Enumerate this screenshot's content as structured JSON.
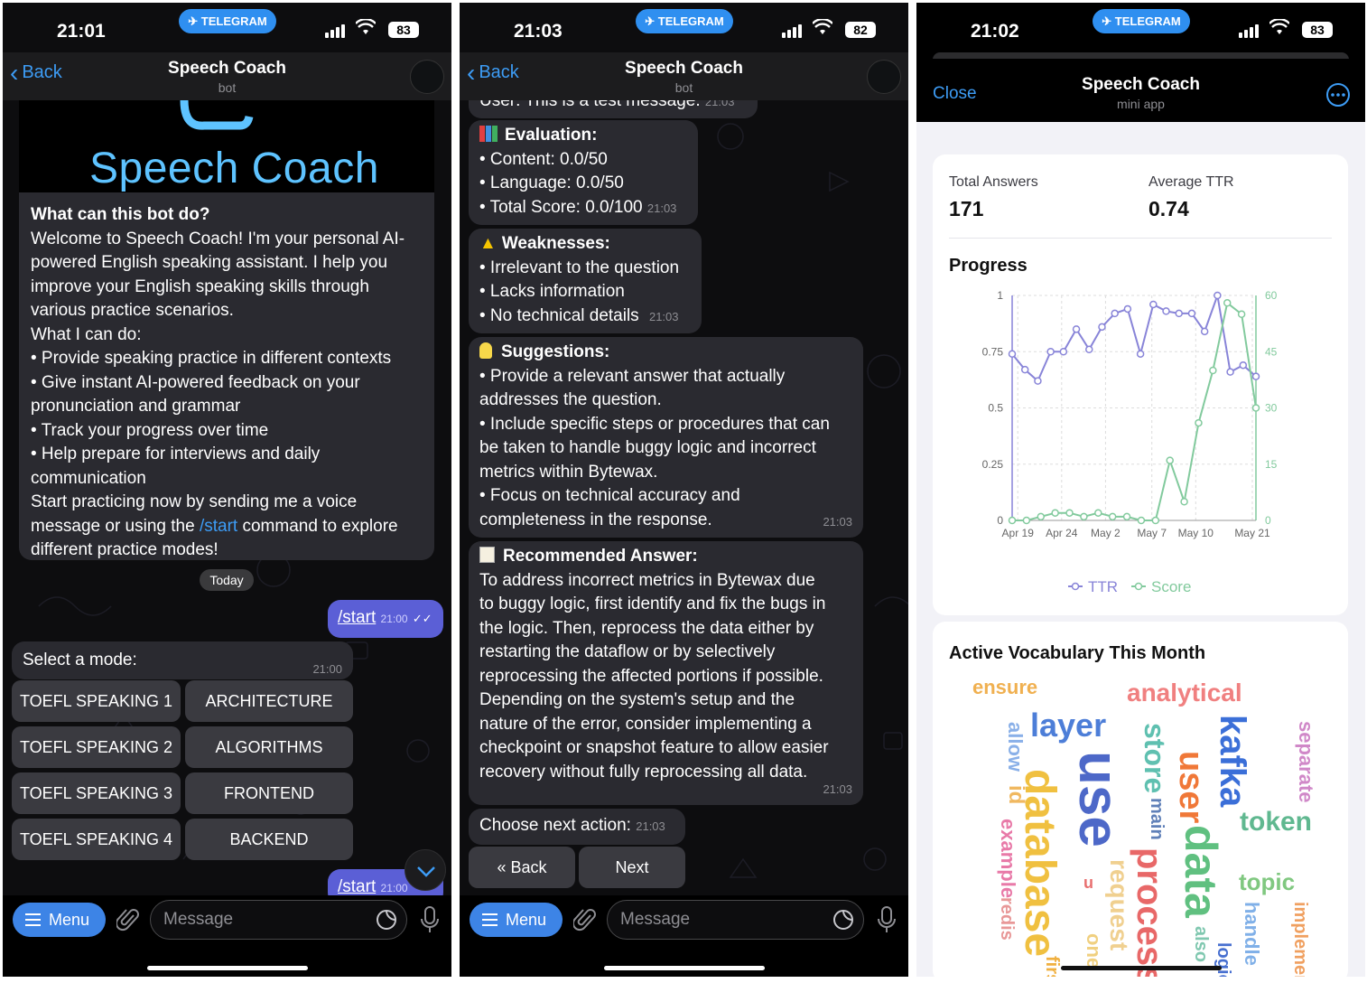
{
  "status": {
    "panel1_time": "21:01",
    "panel2_time": "21:03",
    "panel3_time": "21:02",
    "telegram": "TELEGRAM",
    "panel1_battery": "83",
    "panel2_battery": "82",
    "panel3_battery": "83"
  },
  "chat": {
    "back_label": "Back",
    "title": "Speech Coach",
    "subtitle": "bot",
    "menu_label": "Menu",
    "message_placeholder": "Message"
  },
  "panel1": {
    "logo_text": "Speech Coach",
    "intro_heading": "What can this bot do?",
    "intro_lines": [
      "Welcome to Speech Coach! I'm your personal AI-",
      "powered English speaking assistant. I help you",
      "improve your English speaking skills through",
      "various practice scenarios.",
      "What I can do:",
      "• Provide speaking practice in different contexts",
      "• Give instant AI-powered feedback on your",
      "pronunciation and grammar",
      "• Track your progress over time",
      "• Help prepare for interviews and daily",
      "communication",
      "Start practicing now by sending me a voice",
      "message or using the",
      "/start",
      "command to explore",
      "different practice modes!"
    ],
    "date_chip": "Today",
    "out_message": "/start",
    "out_time": "21:00",
    "select_text": "Select a mode:",
    "select_time": "21:00",
    "keyboard": [
      [
        "TOEFL SPEAKING 1",
        "ARCHITECTURE"
      ],
      [
        "TOEFL SPEAKING 2",
        "ALGORITHMS"
      ],
      [
        "TOEFL SPEAKING 3",
        "FRONTEND"
      ],
      [
        "TOEFL SPEAKING 4",
        "BACKEND"
      ]
    ],
    "out_message2": "/start",
    "out_time2": "21:00"
  },
  "panel2": {
    "cut_text": "User: This is a test message.",
    "cut_time": "21:03",
    "evaluation_title": "Evaluation:",
    "evaluation_lines": [
      "• Content: 0.0/50",
      "• Language: 0.0/50",
      "• Total Score: 0.0/100"
    ],
    "evaluation_time": "21:03",
    "weak_title": "Weaknesses:",
    "weak_lines": [
      "• Irrelevant to the question",
      "• Lacks information",
      "• No technical details"
    ],
    "weak_time": "21:03",
    "sugg_title": "Suggestions:",
    "sugg_lines": [
      "• Provide a relevant answer that actually",
      "addresses the question.",
      "• Include specific steps or procedures that can",
      "be taken to handle buggy logic and incorrect",
      "metrics within Bytewax.",
      "• Focus on technical accuracy and",
      "completeness in the response."
    ],
    "sugg_time": "21:03",
    "rec_title": "Recommended Answer:",
    "rec_lines": [
      "To address incorrect metrics in Bytewax due",
      "to buggy logic, first identify and fix the bugs in",
      "the logic. Then, reprocess the data either by",
      "restarting the dataflow or by selectively",
      "reprocessing the affected portions if possible.",
      "Depending on the system's setup and the",
      "nature of the error, consider implementing a",
      "checkpoint or snapshot feature to allow easier",
      "recovery without fully reprocessing all data."
    ],
    "rec_time": "21:03",
    "next_text": "Choose next action:",
    "next_time": "21:03",
    "btn_back": "« Back",
    "btn_next": "Next"
  },
  "panel3": {
    "close": "Close",
    "title": "Speech Coach",
    "subtitle": "mini app",
    "total_label": "Total Answers",
    "total_value": "171",
    "avg_label": "Average TTR",
    "avg_value": "0.74",
    "progress_title": "Progress",
    "vocab_title": "Active Vocabulary This Month"
  },
  "chart_data": {
    "type": "line",
    "title": "Progress",
    "x_ticks": [
      "Apr 19",
      "Apr 24",
      "May 2",
      "May 7",
      "May 10",
      "May 21"
    ],
    "y_left_ticks": [
      "0",
      "0.25",
      "0.5",
      "0.75",
      "1"
    ],
    "y_right_ticks": [
      "0",
      "15",
      "30",
      "45",
      "60"
    ],
    "ylim_left": [
      0,
      1
    ],
    "ylim_right": [
      0,
      60
    ],
    "grid": true,
    "legend_position": "bottom",
    "series": [
      {
        "name": "TTR",
        "axis": "left",
        "color": "#8884d8",
        "values": [
          0.74,
          0.67,
          0.62,
          0.75,
          0.75,
          0.85,
          0.76,
          0.86,
          0.92,
          0.94,
          0.74,
          0.96,
          0.93,
          0.92,
          0.92,
          0.84,
          1.0,
          0.66,
          0.69,
          0.64
        ]
      },
      {
        "name": "Score",
        "axis": "right",
        "color": "#82ca9d",
        "values": [
          0,
          0,
          1,
          2,
          2,
          1,
          2,
          1,
          1,
          0,
          0,
          16,
          5,
          26,
          40,
          58,
          55,
          30
        ]
      }
    ]
  },
  "wordcloud": [
    {
      "w": "ensure",
      "c": "#f0b050",
      "s": 22,
      "x": 62,
      "y": 747,
      "r": 0
    },
    {
      "w": "analytical",
      "c": "#f08080",
      "s": 28,
      "x": 233,
      "y": 750,
      "r": 0
    },
    {
      "w": "layer",
      "c": "#4d7ed8",
      "s": 36,
      "x": 126,
      "y": 782,
      "r": 0
    },
    {
      "w": "allow",
      "c": "#8ab0e8",
      "s": 22,
      "x": 98,
      "y": 796,
      "r": 90
    },
    {
      "w": "store",
      "c": "#5fc0b0",
      "s": 32,
      "x": 248,
      "y": 797,
      "r": 90
    },
    {
      "w": "kafka",
      "c": "#3b6fd8",
      "s": 40,
      "x": 330,
      "y": 788,
      "r": 90
    },
    {
      "w": "separate",
      "c": "#d088c8",
      "s": 22,
      "x": 420,
      "y": 795,
      "r": 90
    },
    {
      "w": "use",
      "c": "#4d68c8",
      "s": 62,
      "x": 170,
      "y": 828,
      "r": 90
    },
    {
      "w": "user",
      "c": "#f07838",
      "s": 38,
      "x": 285,
      "y": 828,
      "r": 90
    },
    {
      "w": "id",
      "c": "#f0b860",
      "s": 24,
      "x": 98,
      "y": 866,
      "r": 90
    },
    {
      "w": "main",
      "c": "#5f80b8",
      "s": 20,
      "x": 256,
      "y": 880,
      "r": 90
    },
    {
      "w": "token",
      "c": "#60b890",
      "s": 30,
      "x": 358,
      "y": 892,
      "r": 0
    },
    {
      "w": "database",
      "c": "#f0c040",
      "s": 48,
      "x": 112,
      "y": 848,
      "r": 90
    },
    {
      "w": "example",
      "c": "#e87aa8",
      "s": 22,
      "x": 90,
      "y": 903,
      "r": 90
    },
    {
      "w": "data",
      "c": "#60c080",
      "s": 50,
      "x": 290,
      "y": 910,
      "r": 90
    },
    {
      "w": "request",
      "c": "#f0d090",
      "s": 28,
      "x": 210,
      "y": 948,
      "r": 90
    },
    {
      "w": "process",
      "c": "#e86868",
      "s": 40,
      "x": 238,
      "y": 935,
      "r": 90
    },
    {
      "w": "topic",
      "c": "#80c880",
      "s": 26,
      "x": 357,
      "y": 960,
      "r": 0
    },
    {
      "w": "redis",
      "c": "#e89898",
      "s": 20,
      "x": 90,
      "y": 990,
      "r": 90
    },
    {
      "w": "handle",
      "c": "#80b0e8",
      "s": 22,
      "x": 360,
      "y": 995,
      "r": 90
    },
    {
      "w": "implement",
      "c": "#f0a060",
      "s": 20,
      "x": 415,
      "y": 995,
      "r": 90
    },
    {
      "w": "also",
      "c": "#80c8b0",
      "s": 20,
      "x": 305,
      "y": 1022,
      "r": 90
    },
    {
      "w": "logic",
      "c": "#4870d0",
      "s": 20,
      "x": 330,
      "y": 1040,
      "r": 90
    },
    {
      "w": "one",
      "c": "#f0d080",
      "s": 22,
      "x": 185,
      "y": 1030,
      "r": 90
    },
    {
      "w": "first",
      "c": "#f0b040",
      "s": 20,
      "x": 140,
      "y": 1055,
      "r": 90
    },
    {
      "w": "u",
      "c": "#e87070",
      "s": 18,
      "x": 185,
      "y": 965,
      "r": 0
    }
  ]
}
